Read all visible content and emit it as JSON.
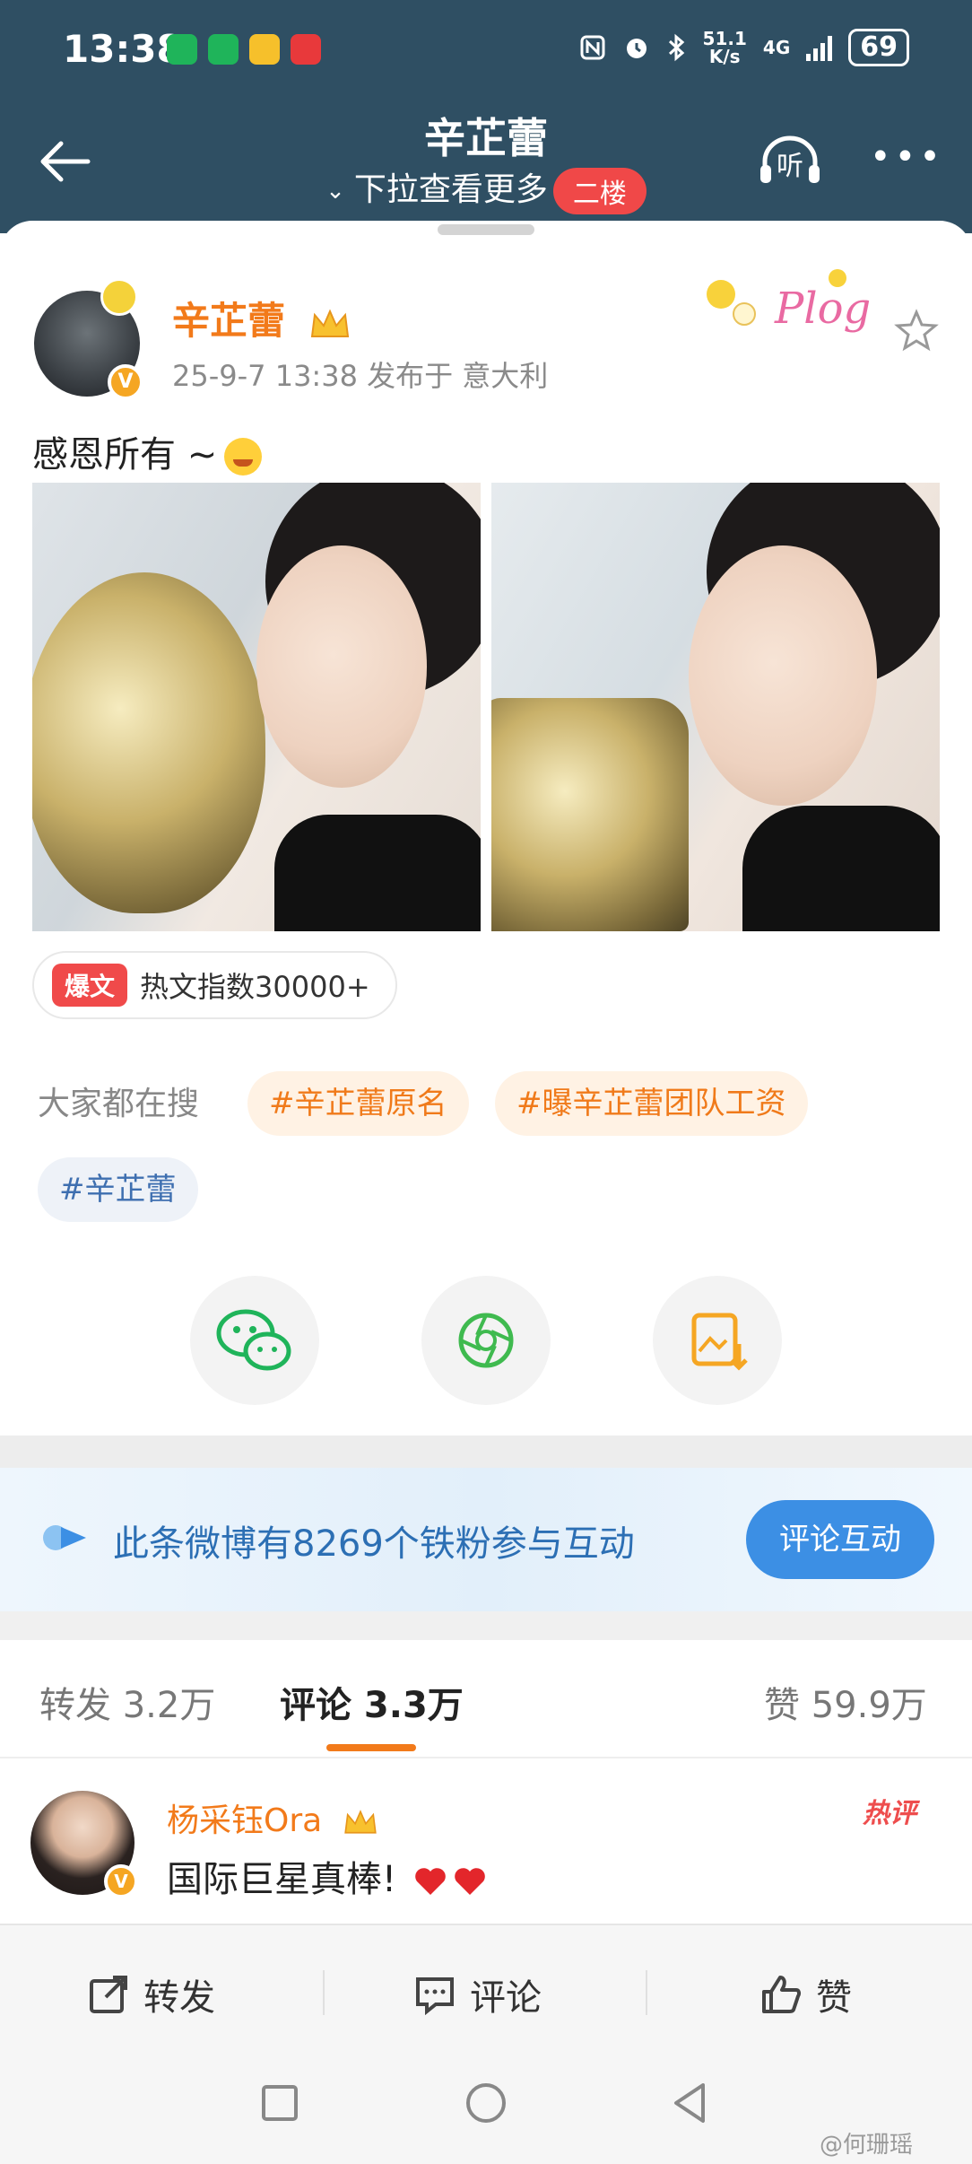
{
  "status_bar": {
    "time": "13:38",
    "net_speed_value": "51.1",
    "net_speed_unit": "K/s",
    "network": "4G",
    "battery": "69"
  },
  "nav": {
    "title": "辛芷蕾",
    "subtitle": "下拉查看更多",
    "floor_badge": "二楼",
    "listen_label": "听"
  },
  "post": {
    "author": "辛芷蕾",
    "meta": "25-9-7 13:38  发布于 意大利",
    "sticker_text": "Plog",
    "text": "感恩所有 ~",
    "hot_tag": "爆文",
    "hot_index": "热文指数30000+"
  },
  "trending": {
    "label": "大家都在搜",
    "chips": [
      "#辛芷蕾原名",
      "#曝辛芷蕾团队工资",
      "#辛芷蕾"
    ]
  },
  "share_icons": [
    "wechat-icon",
    "moments-icon",
    "save-image-icon"
  ],
  "banner": {
    "text": "此条微博有8269个铁粉参与互动",
    "button": "评论互动"
  },
  "tabs": {
    "repost": "转发 3.2万",
    "comment": "评论 3.3万",
    "like": "赞 59.9万"
  },
  "comment": {
    "user": "杨采钰Ora",
    "text": "国际巨星真棒!",
    "hot_label": "热评"
  },
  "actions": {
    "repost": "转发",
    "comment": "评论",
    "like": "赞"
  },
  "watermark": "@何珊瑶",
  "colors": {
    "header_bg": "#2f4f63",
    "accent_orange": "#f27a1a",
    "hot_red": "#f04848",
    "link_blue": "#2c6fb4",
    "button_blue": "#3c8fe4"
  }
}
